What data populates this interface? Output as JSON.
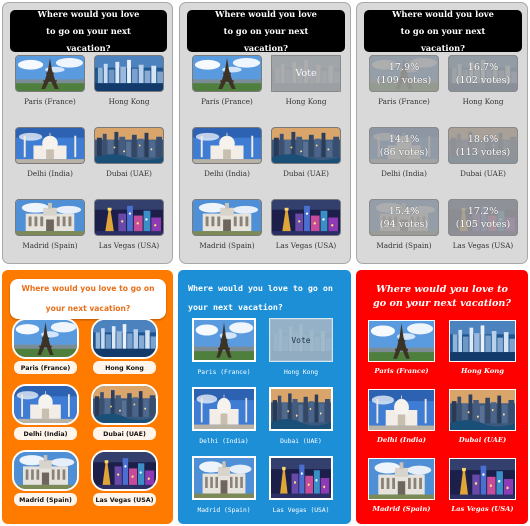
{
  "question": "Where would you love to go on your next vacation?",
  "vote_label": "Vote",
  "destinations": [
    {
      "name": "Paris (France)",
      "image": "eiffel-tower"
    },
    {
      "name": "Hong Kong",
      "image": "city-skyline"
    },
    {
      "name": "Delhi (India)",
      "image": "taj-mahal"
    },
    {
      "name": "Dubai (UAE)",
      "image": "dubai-marina"
    },
    {
      "name": "Madrid (Spain)",
      "image": "madrid-building"
    },
    {
      "name": "Las Vegas (USA)",
      "image": "las-vegas"
    }
  ],
  "results": [
    {
      "percent": "17.9%",
      "votes": "(109 votes)"
    },
    {
      "percent": "16.7%",
      "votes": "(102 votes)"
    },
    {
      "percent": "14.1%",
      "votes": "(86 votes)"
    },
    {
      "percent": "18.6%",
      "votes": "(113 votes)"
    },
    {
      "percent": "15.4%",
      "votes": "(94 votes)"
    },
    {
      "percent": "17.2%",
      "votes": "(105 votes)"
    }
  ],
  "panels": [
    {
      "style": "gray",
      "state": "options"
    },
    {
      "style": "gray",
      "state": "hover-vote"
    },
    {
      "style": "gray",
      "state": "results"
    },
    {
      "style": "orange",
      "state": "options"
    },
    {
      "style": "blue",
      "state": "hover-vote"
    },
    {
      "style": "red",
      "state": "options"
    }
  ],
  "colors": {
    "gray_bg": "#d9d9d9",
    "orange_bg": "#ff7b00",
    "blue_bg": "#1d8fd6",
    "red_bg": "#ff0000",
    "question_black": "#000000"
  }
}
